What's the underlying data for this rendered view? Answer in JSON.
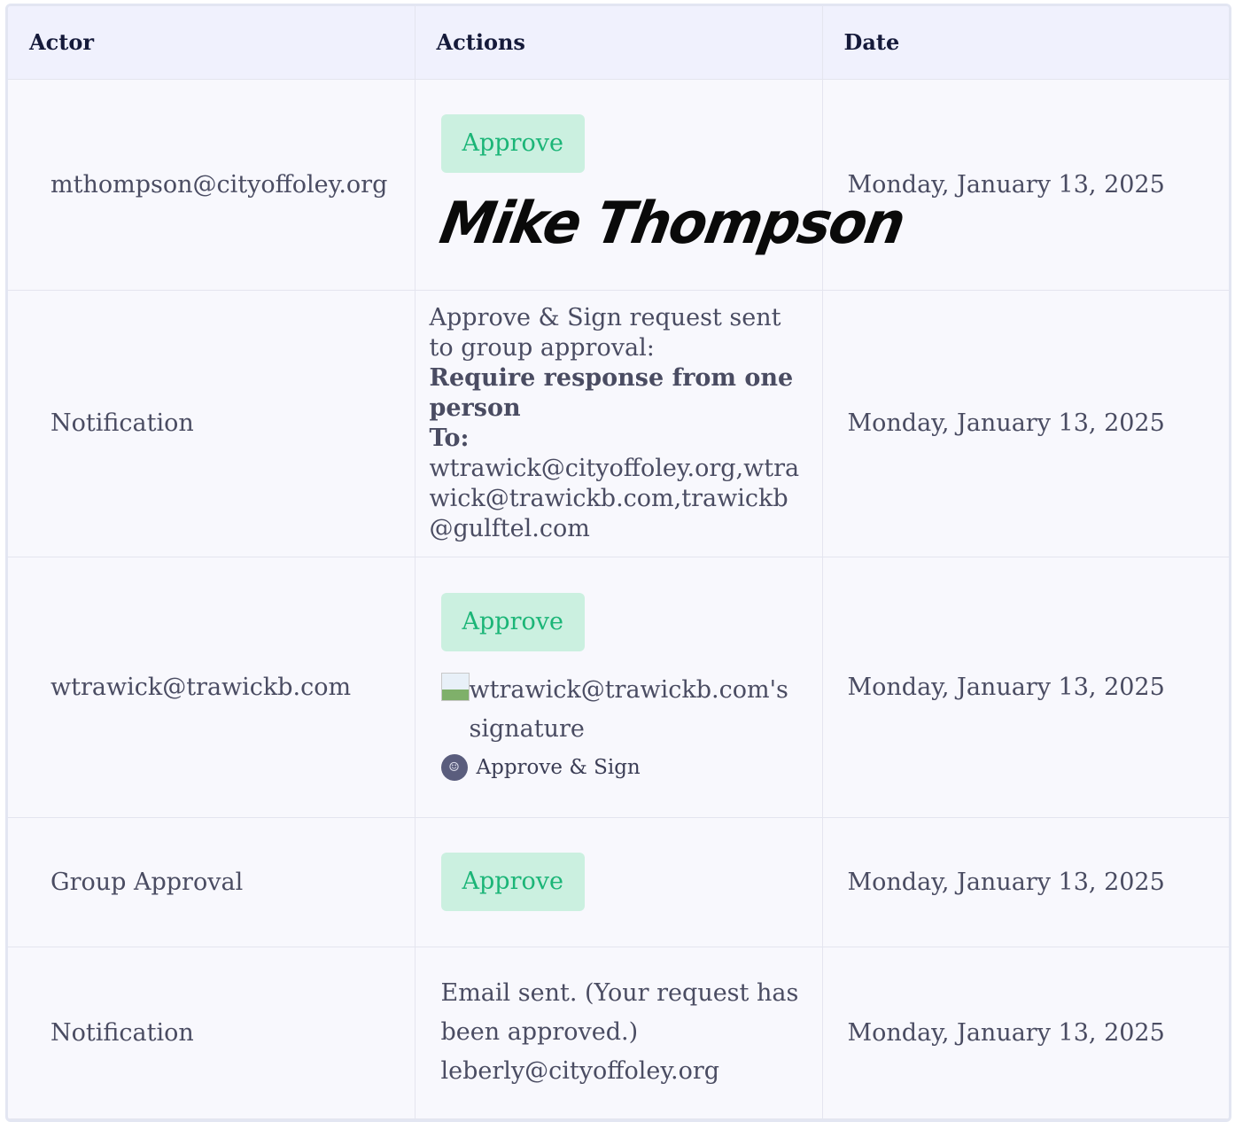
{
  "columns": {
    "actor": "Actor",
    "actions": "Actions",
    "date": "Date"
  },
  "rows": [
    {
      "actor": "mthompson@cityoffoley.org",
      "approve_label": "Approve",
      "signature_text": "Mike Thompson",
      "date": "Monday, January 13, 2025"
    },
    {
      "actor": "Notification",
      "line1": "Approve & Sign request sent to group approval:",
      "bold1": "Require response from one person",
      "to_label": "To:",
      "recipients": "wtrawick@cityoffoley.org,wtrawick@trawickb.com,trawickb@gulftel.com",
      "date": "Monday, January 13, 2025"
    },
    {
      "actor": "wtrawick@trawickb.com",
      "approve_label": "Approve",
      "signature_alt": "wtrawick@trawickb.com's signature",
      "approve_sign_label": "Approve & Sign",
      "avatar_icon": "user-avatar-icon",
      "date": "Monday, January 13, 2025"
    },
    {
      "actor": "Group Approval",
      "approve_label": "Approve",
      "date": "Monday, January 13, 2025"
    },
    {
      "actor": "Notification",
      "email_line1": "Email sent. (Your request has",
      "email_line2": "been approved.)",
      "email_line3": "leberly@cityoffoley.org",
      "date": "Monday, January 13, 2025"
    }
  ],
  "colors": {
    "approve_bg": "#cbf0e0",
    "approve_text": "#1bb577",
    "header_bg": "#f0f1fd"
  }
}
